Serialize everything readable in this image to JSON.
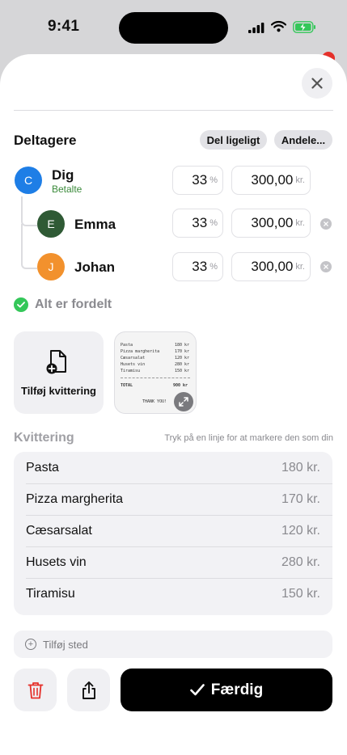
{
  "status": {
    "time": "9:41"
  },
  "participants": {
    "title": "Deltagere",
    "split_equal_label": "Del ligeligt",
    "shares_label": "Andele...",
    "people": [
      {
        "initial": "C",
        "name": "Dig",
        "status": "Betalte",
        "percent": "33",
        "percent_unit": "%",
        "amount": "300,00",
        "currency": "kr.",
        "color": "#1e7ee6"
      },
      {
        "initial": "E",
        "name": "Emma",
        "percent": "33",
        "percent_unit": "%",
        "amount": "300,00",
        "currency": "kr.",
        "color": "#2f5a35"
      },
      {
        "initial": "J",
        "name": "Johan",
        "percent": "33",
        "percent_unit": "%",
        "amount": "300,00",
        "currency": "kr.",
        "color": "#f2912d"
      }
    ],
    "all_distributed": "Alt er fordelt"
  },
  "receipt": {
    "add_label": "Tilføj kvittering",
    "thumbnail": {
      "lines": [
        {
          "name": "Pasta",
          "price": "180 kr"
        },
        {
          "name": "Pizza margherita",
          "price": "170 kr"
        },
        {
          "name": "Cæsarsalat",
          "price": "120 kr"
        },
        {
          "name": "Husets vin",
          "price": "280 kr"
        },
        {
          "name": "Tiramisu",
          "price": "150 kr"
        }
      ],
      "total_label": "TOTAL",
      "total_value": "900 kr",
      "thanks": "THANK YOU!"
    }
  },
  "receipt_list": {
    "title": "Kvittering",
    "hint": "Tryk på en linje for at markere den som din",
    "items": [
      {
        "name": "Pasta",
        "price": "180 kr."
      },
      {
        "name": "Pizza margherita",
        "price": "170 kr."
      },
      {
        "name": "Cæsarsalat",
        "price": "120 kr."
      },
      {
        "name": "Husets vin",
        "price": "280 kr."
      },
      {
        "name": "Tiramisu",
        "price": "150 kr."
      }
    ]
  },
  "add_place_label": "Tilføj sted",
  "done_label": "Færdig",
  "colors": {
    "accent": "#000000",
    "success": "#34c759",
    "delete": "#e5302a"
  }
}
